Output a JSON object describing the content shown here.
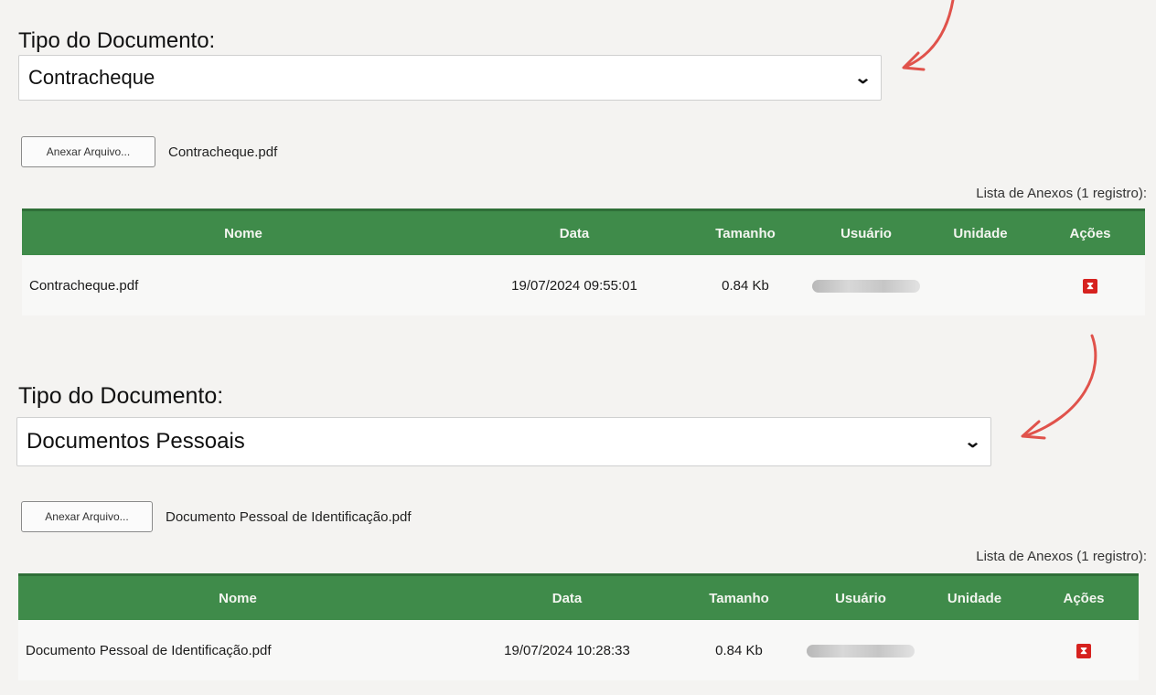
{
  "panels": [
    {
      "label": "Tipo do Documento:",
      "selected": "Contracheque",
      "attach_label": "Anexar Arquivo...",
      "file_name": "Contracheque.pdf",
      "list_caption": "Lista de Anexos (1 registro):",
      "columns": [
        "Nome",
        "Data",
        "Tamanho",
        "Usuário",
        "Unidade",
        "Ações"
      ],
      "rows": [
        {
          "nome": "Contracheque.pdf",
          "data": "19/07/2024 09:55:01",
          "tamanho": "0.84 Kb",
          "unidade": ""
        }
      ]
    },
    {
      "label": "Tipo do Documento:",
      "selected": "Documentos Pessoais",
      "attach_label": "Anexar Arquivo...",
      "file_name": "Documento Pessoal de Identificação.pdf",
      "list_caption": "Lista de Anexos (1 registro):",
      "columns": [
        "Nome",
        "Data",
        "Tamanho",
        "Usuário",
        "Unidade",
        "Ações"
      ],
      "rows": [
        {
          "nome": "Documento Pessoal de Identificação.pdf",
          "data": "19/07/2024 10:28:33",
          "tamanho": "0.84 Kb",
          "unidade": ""
        }
      ]
    }
  ],
  "icons": {
    "select": "chevron-down-icon",
    "delete": "delete-icon",
    "annotation": "curved-arrow-icon"
  },
  "colors": {
    "header_green": "#3f8b4a",
    "delete_red": "#d6221f",
    "arrow_red": "#e0524b"
  }
}
